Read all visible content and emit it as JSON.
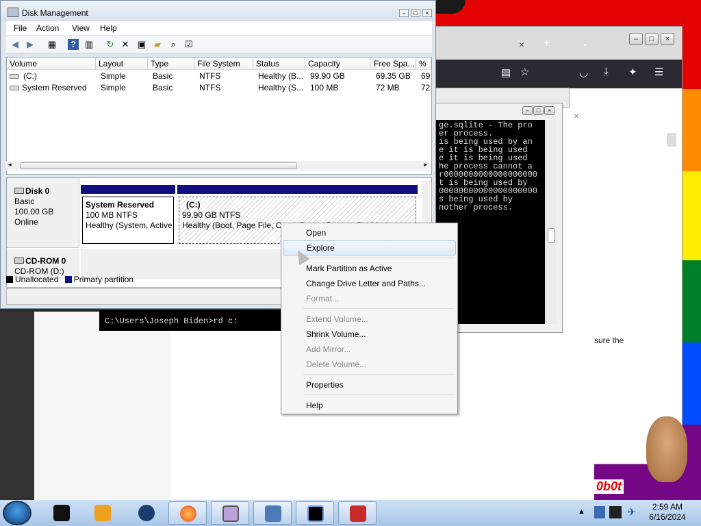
{
  "window": {
    "title": "Disk Management"
  },
  "menu": [
    "File",
    "Action",
    "View",
    "Help"
  ],
  "toolbar": {
    "icons": [
      "back-arrow-icon",
      "forward-arrow-icon",
      "properties-icon",
      "help-icon",
      "snapin-icon",
      "refresh-icon",
      "delete-icon",
      "settings-icon",
      "open-folder-icon",
      "search-icon",
      "checklist-icon"
    ]
  },
  "list": {
    "columns": [
      "Volume",
      "Layout",
      "Type",
      "File System",
      "Status",
      "Capacity",
      "Free Spa...",
      "%"
    ],
    "rows": [
      [
        "(C:)",
        "Simple",
        "Basic",
        "NTFS",
        "Healthy (B...",
        "99.90 GB",
        "69.35 GB",
        "69"
      ],
      [
        "System Reserved",
        "Simple",
        "Basic",
        "NTFS",
        "Healthy (S...",
        "100 MB",
        "72 MB",
        "72"
      ]
    ]
  },
  "disk0": {
    "name": "Disk 0",
    "type": "Basic",
    "size": "100.00 GB",
    "state": "Online"
  },
  "cdrom": {
    "name": "CD-ROM 0",
    "drive": "CD-ROM (D:)"
  },
  "partitions": {
    "reserved": {
      "name": "System Reserved",
      "size": "100 MB NTFS",
      "status": "Healthy (System, Active"
    },
    "c": {
      "name": "(C:)",
      "size": "99.90 GB NTFS",
      "status": "Healthy (Boot, Page File, Crash Dump, Primary Partition)"
    }
  },
  "legend": {
    "unallocated": "Unallocated",
    "primary": "Primary partition",
    "unallocated_color": "#000000",
    "primary_color": "#0f0f80"
  },
  "context_menu": {
    "items": [
      {
        "label": "Open",
        "enabled": true
      },
      {
        "label": "Explore",
        "enabled": true,
        "highlighted": true
      },
      {
        "sep": true
      },
      {
        "label": "Mark Partition as Active",
        "enabled": true
      },
      {
        "label": "Change Drive Letter and Paths...",
        "enabled": true
      },
      {
        "label": "Format...",
        "enabled": false
      },
      {
        "sep": true
      },
      {
        "label": "Extend Volume...",
        "enabled": false
      },
      {
        "label": "Shrink Volume...",
        "enabled": true
      },
      {
        "label": "Add Mirror...",
        "enabled": false
      },
      {
        "label": "Delete Volume...",
        "enabled": false
      },
      {
        "sep": true
      },
      {
        "label": "Properties",
        "enabled": true
      },
      {
        "sep": true
      },
      {
        "label": "Help",
        "enabled": true
      }
    ]
  },
  "console": {
    "lines": [
      "ge.sqlite - The pro",
      "er process.",
      "is being used by an",
      "",
      "e it is being used",
      "",
      "e it is being used",
      "",
      "he process cannot a",
      "",
      "r0000000000000000000",
      "t is being used by",
      "",
      "00000000000000000000",
      "s being used by",
      "",
      "nother process."
    ],
    "prompt": "C:\\Users\\Joseph Biden>rd c:"
  },
  "browser": {
    "page_text": "sure the",
    "bottom_text": "0b0t"
  },
  "taskbar": {
    "time": "2:59 AM",
    "date": "6/16/2024"
  },
  "colors": {
    "rainbow": [
      "#e40303",
      "#ff8c00",
      "#ffed00",
      "#008026",
      "#004dff",
      "#750787"
    ]
  }
}
